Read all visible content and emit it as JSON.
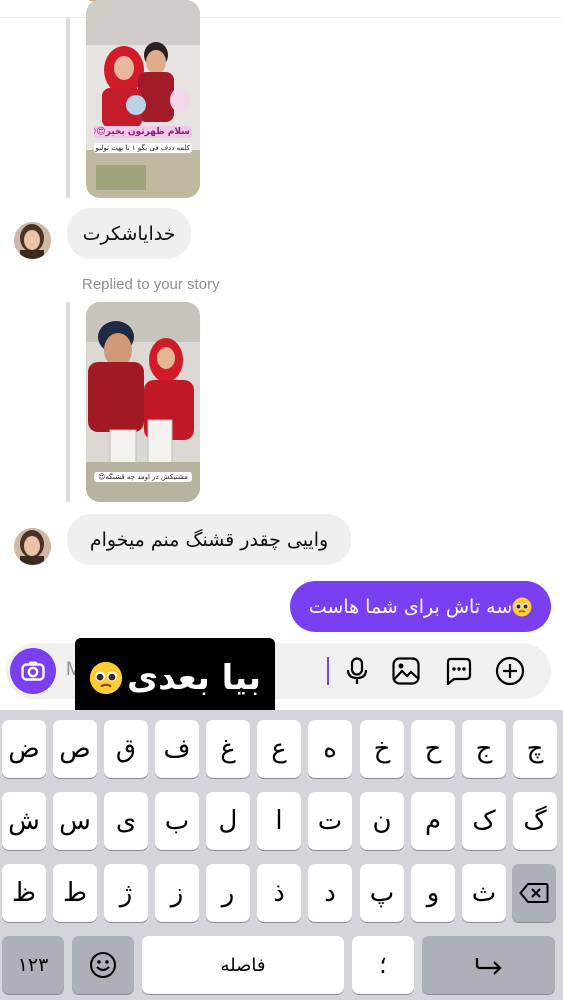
{
  "conversation": {
    "replied_label": "Replied to your story",
    "story1": {
      "caption_top": "سلام ظهرتون بخیر😍😍",
      "caption_bottom": "کلمه ددف فی بگو ۱ تا بهت تولیو بدم😍"
    },
    "story2": {
      "caption": "مشتیکش در اومد چه قشنگه😍"
    },
    "messages": [
      {
        "direction": "incoming",
        "text": "خدایاشکرت"
      },
      {
        "direction": "incoming",
        "text": "واییی چقدر قشنگ منم میخوام"
      },
      {
        "direction": "outgoing",
        "text": "سه تاش برای شما هاست",
        "emoji": "pleading-face"
      }
    ]
  },
  "composer": {
    "hint": "M",
    "icons": [
      "camera-icon",
      "microphone-icon",
      "gallery-icon",
      "sticker-chat-icon",
      "plus-icon"
    ]
  },
  "sticker": {
    "text": "بیا بعدی",
    "emoji": "pleading-face"
  },
  "keyboard": {
    "row1": [
      "چ",
      "ج",
      "ح",
      "خ",
      "ه",
      "ع",
      "غ",
      "ف",
      "ق",
      "ص",
      "ض"
    ],
    "row2": [
      "گ",
      "ک",
      "م",
      "ن",
      "ت",
      "ا",
      "ل",
      "ب",
      "ی",
      "س",
      "ش"
    ],
    "row3": [
      "ث",
      "و",
      "پ",
      "د",
      "ذ",
      "ر",
      "ز",
      "ژ",
      "ط",
      "ظ"
    ],
    "numbers_key": "۱۲۳",
    "space_key": "فاصله",
    "punct_key": "؛",
    "colors": {
      "background": "#d3d5db",
      "key": "#ffffff",
      "dark_key": "#abb0ba"
    }
  },
  "colors": {
    "accent": "#7b3ff2",
    "incoming_bubble": "#efefef",
    "muted_text": "#8e8e93"
  }
}
